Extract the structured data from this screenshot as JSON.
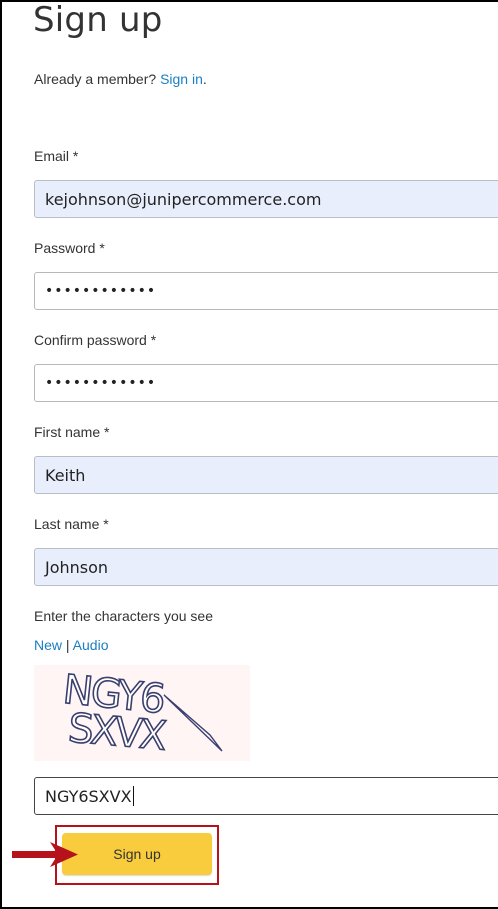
{
  "page": {
    "title": "Sign up"
  },
  "member": {
    "prompt": "Already a member?",
    "link": "Sign in",
    "period": "."
  },
  "fields": {
    "email": {
      "label": "Email *",
      "value": "kejohnson@junipercommerce.com"
    },
    "password": {
      "label": "Password *",
      "value": "••••••••••••"
    },
    "confirm": {
      "label": "Confirm password *",
      "value": "••••••••••••"
    },
    "first_name": {
      "label": "First name *",
      "value": "Keith"
    },
    "last_name": {
      "label": "Last name *",
      "value": "Johnson"
    }
  },
  "captcha": {
    "instruction": "Enter the characters you see",
    "new_link": "New",
    "separator": "|",
    "audio_link": "Audio",
    "image_text_line1": "NGY6",
    "image_text_line2": "SXVX",
    "value": "NGY6SXVX"
  },
  "submit": {
    "label": "Sign up"
  },
  "colors": {
    "link": "#1a7ec2",
    "button": "#f8cc3c",
    "highlight": "#b5121b",
    "autofill": "#e8eefb"
  }
}
